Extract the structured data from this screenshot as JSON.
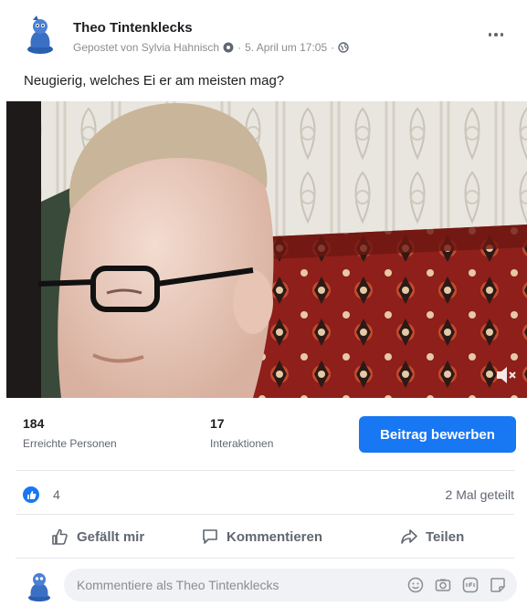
{
  "post": {
    "page_name": "Theo Tintenklecks",
    "posted_by": "Gepostet von Sylvia Hahnisch",
    "separator": "·",
    "date": "5. April um 17:05",
    "caption": "Neugierig, welches Ei er am meisten mag?"
  },
  "video": {
    "description_icon": "speaker-muted-icon"
  },
  "stats": {
    "reach_value": "184",
    "reach_label": "Erreichte Personen",
    "interactions_value": "17",
    "interactions_label": "Interaktionen",
    "promote_label": "Beitrag bewerben"
  },
  "reactions": {
    "like_count": "4",
    "shares": "2 Mal geteilt"
  },
  "actions": {
    "like": "Gefällt mir",
    "comment": "Kommentieren",
    "share": "Teilen"
  },
  "composer": {
    "placeholder": "Kommentiere als Theo Tintenklecks",
    "icons": [
      "emoji-icon",
      "camera-icon",
      "gif-icon",
      "sticker-icon"
    ]
  },
  "colors": {
    "accent": "#1877f2",
    "text_secondary": "#606770"
  }
}
